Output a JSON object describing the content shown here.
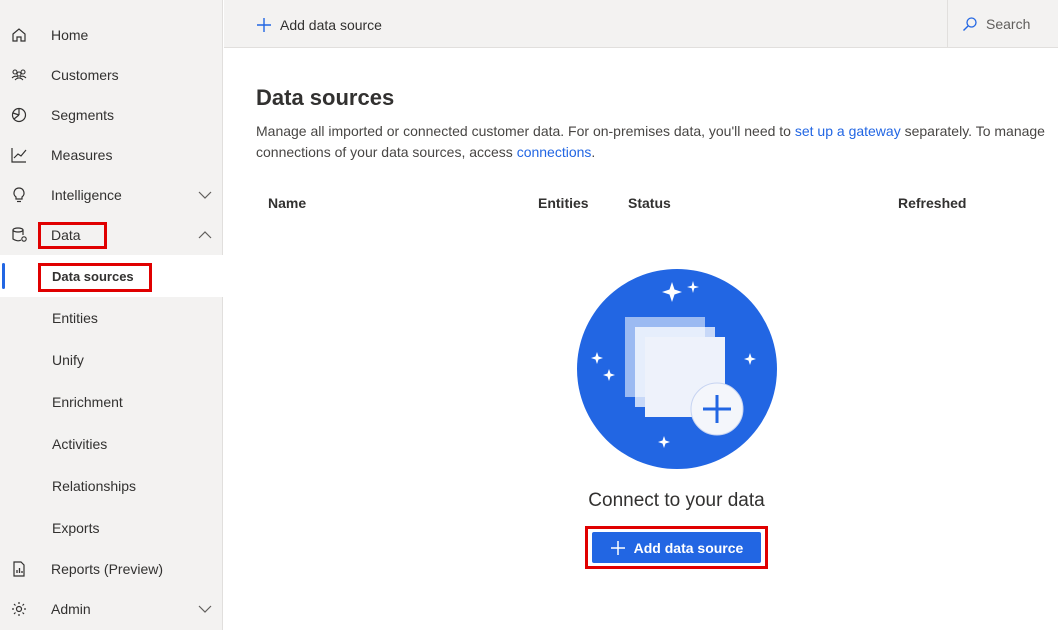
{
  "sidebar": {
    "items": [
      {
        "label": "Home",
        "icon": "home-icon"
      },
      {
        "label": "Customers",
        "icon": "people-icon"
      },
      {
        "label": "Segments",
        "icon": "pie-icon"
      },
      {
        "label": "Measures",
        "icon": "chart-line-icon"
      },
      {
        "label": "Intelligence",
        "icon": "lightbulb-icon"
      },
      {
        "label": "Data",
        "icon": "database-gear-icon"
      }
    ],
    "data_children": [
      "Data sources",
      "Entities",
      "Unify",
      "Enrichment",
      "Activities",
      "Relationships",
      "Exports"
    ],
    "bottom_items": [
      {
        "label": "Reports (Preview)",
        "icon": "report-icon"
      },
      {
        "label": "Admin",
        "icon": "gear-icon"
      }
    ]
  },
  "toolbar": {
    "add_label": "Add data source",
    "search_label": "Search"
  },
  "main": {
    "title": "Data sources",
    "desc_part1": "Manage all imported or connected customer data. For on-premises data, you'll need to ",
    "desc_link1": "set up a gateway",
    "desc_part2": " separately. To manage connections of your data sources, access ",
    "desc_link2": "connections",
    "desc_part3": ".",
    "columns": [
      "Name",
      "Entities",
      "Status",
      "Refreshed"
    ],
    "empty_title": "Connect to your data",
    "add_button_label": "Add data source"
  },
  "colors": {
    "accent": "#2266e3",
    "highlight": "#e00000",
    "sidebar_bg": "#f3f2f1"
  }
}
